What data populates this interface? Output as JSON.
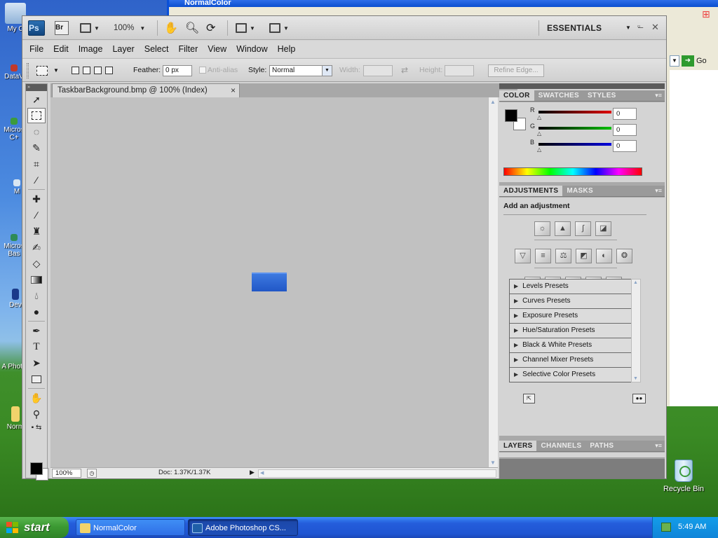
{
  "desktop": {
    "icons": [
      "My C",
      "DataV",
      "Micros C+",
      "M",
      "Micros Bas",
      "Dev",
      "A Photo",
      "Norm"
    ],
    "recycle_bin": "Recycle Bin",
    "bg_window": {
      "title": "NormalColor",
      "go_label": "Go"
    }
  },
  "photoshop": {
    "logo": "Ps",
    "bridge_logo": "Br",
    "zoom_level": "100%",
    "workspace": "ESSENTIALS",
    "menu": [
      "File",
      "Edit",
      "Image",
      "Layer",
      "Select",
      "Filter",
      "View",
      "Window",
      "Help"
    ],
    "options": {
      "feather_label": "Feather:",
      "feather_value": "0 px",
      "antialias_label": "Anti-alias",
      "style_label": "Style:",
      "style_value": "Normal",
      "width_label": "Width:",
      "height_label": "Height:",
      "refine_edge": "Refine Edge..."
    },
    "document": {
      "tab_title": "TaskbarBackground.bmp @ 100% (Index)",
      "close": "×",
      "image_color": "#2f63d6"
    },
    "status": {
      "zoom": "100%",
      "doc_info": "Doc: 1.37K/1.37K"
    },
    "color_panel": {
      "tabs": [
        "COLOR",
        "SWATCHES",
        "STYLES"
      ],
      "r_label": "R",
      "g_label": "G",
      "b_label": "B",
      "r_value": "0",
      "g_value": "0",
      "b_value": "0"
    },
    "adjustments_panel": {
      "tabs": [
        "ADJUSTMENTS",
        "MASKS"
      ],
      "title": "Add an adjustment",
      "presets": [
        "Levels Presets",
        "Curves Presets",
        "Exposure Presets",
        "Hue/Saturation Presets",
        "Black & White Presets",
        "Channel Mixer Presets",
        "Selective Color Presets"
      ]
    },
    "layers_panel": {
      "tabs": [
        "LAYERS",
        "CHANNELS",
        "PATHS"
      ]
    }
  },
  "taskbar": {
    "start": "start",
    "tasks": [
      "NormalColor",
      "Adobe Photoshop CS..."
    ],
    "clock": "5:49 AM"
  }
}
